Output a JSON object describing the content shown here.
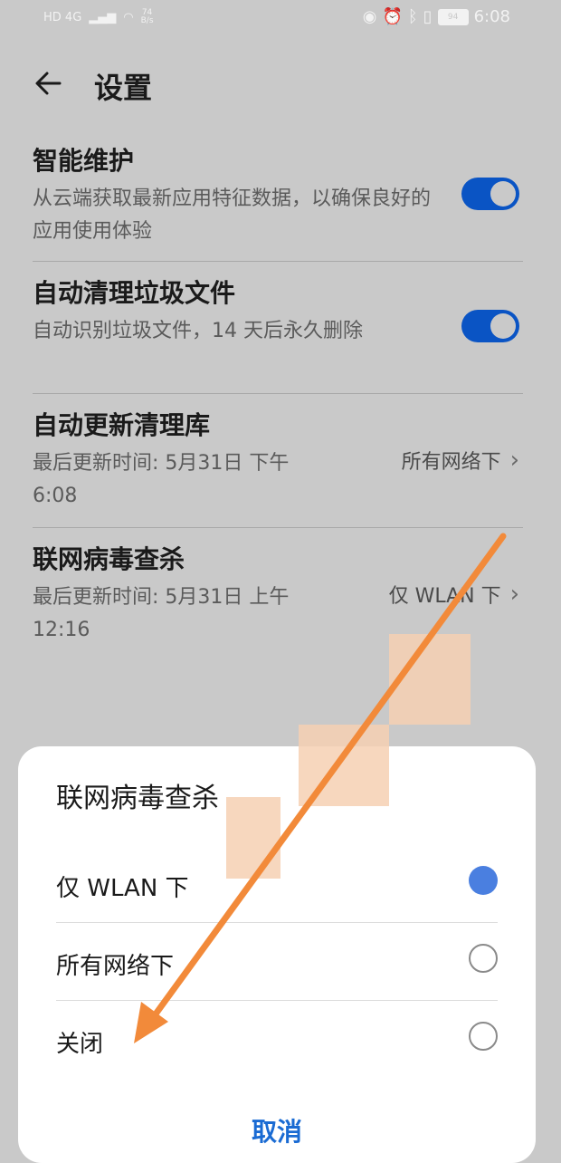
{
  "status_bar": {
    "left_text": "HD 4G",
    "speed_value": "74",
    "speed_unit": "B/s",
    "battery": "94",
    "time": "6:08"
  },
  "header": {
    "title": "设置"
  },
  "settings": [
    {
      "title": "智能维护",
      "subtitle": "从云端获取最新应用特征数据，以确保良好的应用使用体验",
      "toggle_on": true
    },
    {
      "title": "自动清理垃圾文件",
      "subtitle": "自动识别垃圾文件，14 天后永久删除",
      "toggle_on": true
    },
    {
      "title": "自动更新清理库",
      "subtitle": "最后更新时间: 5月31日 下午6:08",
      "value": "所有网络下"
    },
    {
      "title": "联网病毒查杀",
      "subtitle": "最后更新时间: 5月31日 上午12:16",
      "value": "仅 WLAN 下"
    }
  ],
  "dialog": {
    "title": "联网病毒查杀",
    "options": [
      {
        "label": "仅 WLAN 下",
        "selected": true
      },
      {
        "label": "所有网络下",
        "selected": false
      },
      {
        "label": "关闭",
        "selected": false
      }
    ],
    "cancel": "取消"
  },
  "colors": {
    "accent": "#0a54c4",
    "annotation_arrow": "#f28a3a"
  }
}
